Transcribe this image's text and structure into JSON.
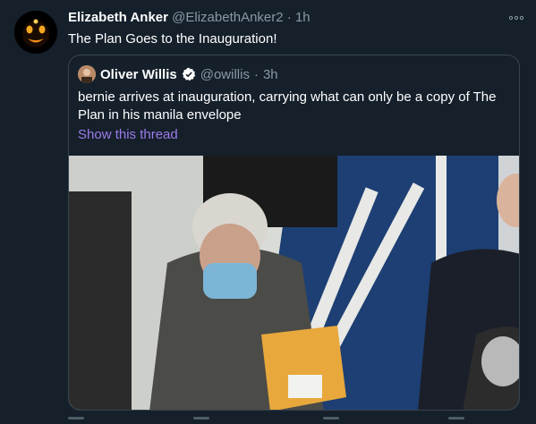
{
  "tweet": {
    "author_name": "Elizabeth Anker",
    "author_handle": "@ElizabethAnker2",
    "separator": "·",
    "time": "1h",
    "text": "The Plan Goes to the Inauguration!",
    "more_icon": "more-dots-icon"
  },
  "quoted": {
    "author_name": "Oliver Willis",
    "author_handle": "@owillis",
    "separator": "·",
    "time": "3h",
    "text": "bernie arrives at inauguration, carrying what can only be a copy of The Plan in his manila envelope",
    "show_thread": "Show this thread",
    "verified_icon": "verified-badge-icon"
  },
  "colors": {
    "background": "#15202b",
    "secondary_text": "#8899a6",
    "link": "#9d7bea",
    "border": "#38444d"
  }
}
